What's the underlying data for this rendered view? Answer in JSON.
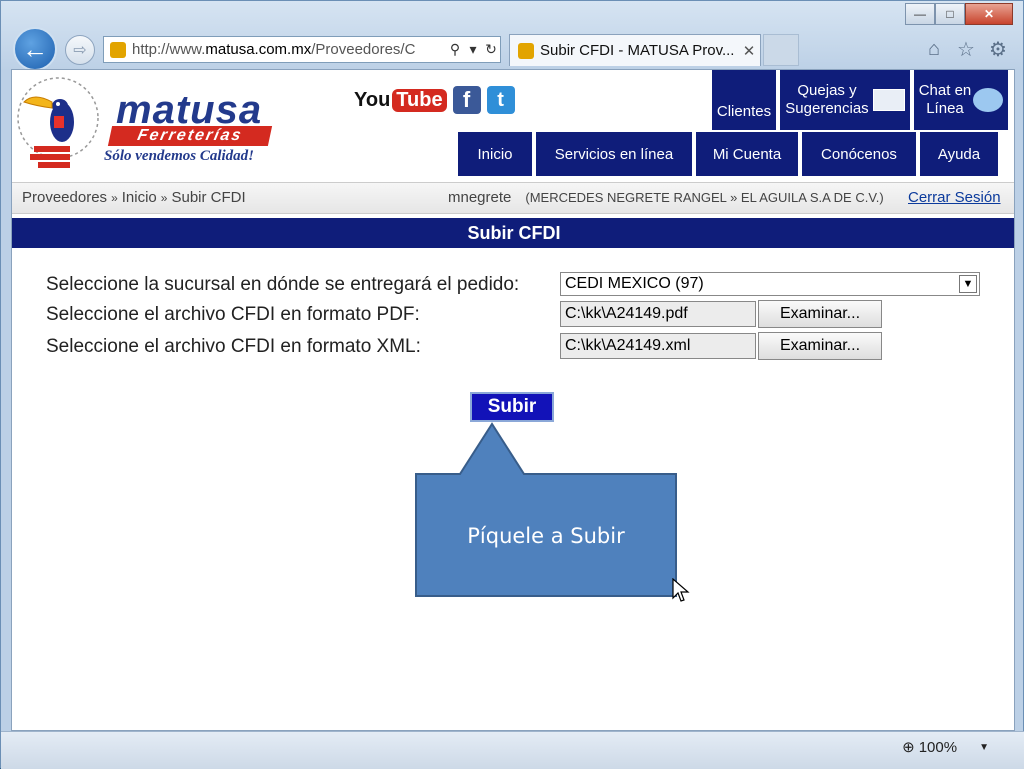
{
  "browser": {
    "url_prefix": "http://www.",
    "url_domain": "matusa.com.mx",
    "url_path": "/Proveedores/C",
    "tab_title": "Subir CFDI - MATUSA Prov...",
    "icons": [
      "back-icon",
      "forward-icon",
      "search-icon",
      "dropdown-icon",
      "refresh-icon",
      "close-tab-icon",
      "home-icon",
      "favorites-star-icon",
      "settings-gear-icon"
    ]
  },
  "site": {
    "brand": "matusa",
    "brand_sub": "Ferreterías",
    "slogan": "Sólo vendemos Calidad!",
    "social": {
      "youtube_you": "You",
      "youtube_tube": "Tube",
      "facebook": "f",
      "twitter": "t"
    },
    "topnav": {
      "clientes": "Clientes",
      "quejas_1": "Quejas y",
      "quejas_2": "Sugerencias",
      "chat_1": "Chat en",
      "chat_2": "Línea"
    },
    "mainnav": [
      "Inicio",
      "Servicios en línea",
      "Mi Cuenta",
      "Conócenos",
      "Ayuda"
    ]
  },
  "breadcrumb": {
    "items": [
      "Proveedores",
      "Inicio",
      "Subir CFDI"
    ],
    "sep": "»"
  },
  "user": {
    "login": "mnegrete",
    "name": "(MERCEDES NEGRETE RANGEL",
    "sep": "»",
    "company": "EL AGUILA S.A DE C.V.)",
    "logout": "Cerrar Sesión"
  },
  "page_title": "Subir CFDI",
  "form": {
    "sucursal_label": "Seleccione la sucursal en dónde se entregará el pedido:",
    "sucursal_value": "CEDI MEXICO (97)",
    "pdf_label": "Seleccione el archivo CFDI en formato PDF:",
    "pdf_value": "C:\\kk\\A24149.pdf",
    "xml_label": "Seleccione el archivo CFDI en formato XML:",
    "xml_value": "C:\\kk\\A24149.xml",
    "browse_label": "Examinar...",
    "submit_label": "Subir"
  },
  "callout": {
    "text": "Píquele a Subir",
    "color": "#4f81bd"
  },
  "status": {
    "zoom": "100%"
  },
  "colors": {
    "nav_blue": "#0f1d7a",
    "submit_blue": "#1212b8",
    "brand_blue": "#233a8c",
    "brand_red": "#d42a20"
  }
}
